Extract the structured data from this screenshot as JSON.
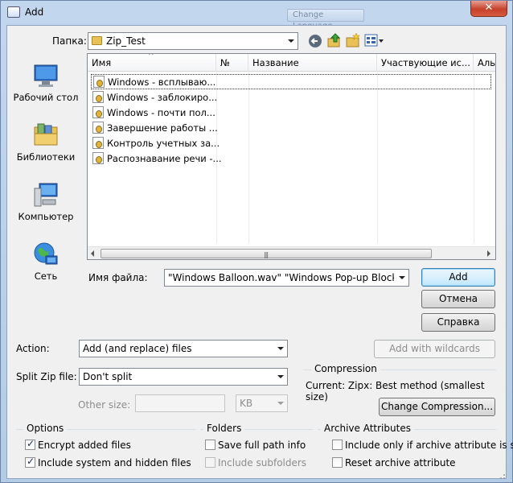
{
  "window": {
    "title": "Add",
    "close_glyph": "✕",
    "background_button_label": "Change Language"
  },
  "toolbar": {
    "folder_label": "Папка:",
    "folder_value": "Zip_Test",
    "icons": [
      "back-arrow-icon",
      "up-folder-icon",
      "new-folder-icon",
      "view-menu-icon"
    ]
  },
  "places": [
    {
      "label": "Рабочий стол",
      "icon": "desktop-icon"
    },
    {
      "label": "Библиотеки",
      "icon": "libraries-icon"
    },
    {
      "label": "Компьютер",
      "icon": "computer-icon"
    },
    {
      "label": "Сеть",
      "icon": "network-icon"
    }
  ],
  "filelist": {
    "columns": [
      "Имя",
      "№",
      "Название",
      "Участвующие ис...",
      "Аль"
    ],
    "files": [
      "Windows - всплываю...",
      "Windows - заблокиро...",
      "Windows - почти пол...",
      "Завершение работы ...",
      "Контроль учетных за...",
      "Распознавание речи -..."
    ]
  },
  "filename": {
    "label": "Имя файла:",
    "value": "\"Windows Balloon.wav\" \"Windows Pop-up Blocked.wav\" \""
  },
  "buttons": {
    "add": "Add",
    "cancel": "Отмена",
    "help": "Справка",
    "add_wildcards": "Add with wildcards",
    "change_compression": "Change Compression..."
  },
  "action": {
    "label": "Action:",
    "value": "Add (and replace) files"
  },
  "split": {
    "label": "Split Zip file:",
    "value": "Don't split"
  },
  "other_size": {
    "label": "Other size:",
    "value": "",
    "unit": "KB"
  },
  "compression": {
    "heading": "Compression",
    "current": "Current: Zipx: Best method (smallest size)"
  },
  "options": {
    "heading": "Options",
    "items": [
      {
        "label": "Encrypt added files",
        "checked": true
      },
      {
        "label": "Include system and hidden files",
        "checked": true
      }
    ]
  },
  "folders": {
    "heading": "Folders",
    "items": [
      {
        "label": "Save full path info",
        "checked": false
      },
      {
        "label": "Include subfolders",
        "checked": false,
        "disabled": true
      }
    ]
  },
  "archive": {
    "heading": "Archive Attributes",
    "items": [
      {
        "label": "Include only if archive attribute is set",
        "checked": false
      },
      {
        "label": "Reset archive attribute",
        "checked": false
      }
    ]
  }
}
